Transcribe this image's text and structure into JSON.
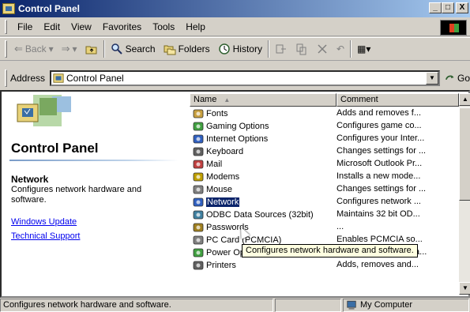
{
  "window": {
    "title": "Control Panel",
    "min_label": "_",
    "max_label": "□",
    "close_label": "X"
  },
  "menu": [
    "File",
    "Edit",
    "View",
    "Favorites",
    "Tools",
    "Help"
  ],
  "toolbar": {
    "back": "Back",
    "search": "Search",
    "folders": "Folders",
    "history": "History",
    "back_arrow": "⇐",
    "forward_arrow": "⇒",
    "dropdown": "▾",
    "undo": "↶",
    "views": "▦▾"
  },
  "address": {
    "label": "Address",
    "value": "Control Panel",
    "go": "Go",
    "dd": "▼"
  },
  "left": {
    "title": "Control Panel",
    "selected_name": "Network",
    "selected_desc": "Configures network hardware and software.",
    "links": [
      "Windows Update",
      "Technical Support"
    ]
  },
  "list": {
    "headers": {
      "name": "Name",
      "comment": "Comment",
      "sort_indicator": "▲"
    },
    "rows": [
      {
        "name": "Fonts",
        "comment": "Adds and removes f...",
        "icon": "fonts-icon"
      },
      {
        "name": "Gaming Options",
        "comment": "Configures game co...",
        "icon": "gaming-icon"
      },
      {
        "name": "Internet Options",
        "comment": "Configures your Inter...",
        "icon": "internet-icon"
      },
      {
        "name": "Keyboard",
        "comment": "Changes settings for ...",
        "icon": "keyboard-icon"
      },
      {
        "name": "Mail",
        "comment": "Microsoft Outlook Pr...",
        "icon": "mail-icon"
      },
      {
        "name": "Modems",
        "comment": "Installs a new mode...",
        "icon": "modem-icon"
      },
      {
        "name": "Mouse",
        "comment": "Changes settings for ...",
        "icon": "mouse-icon"
      },
      {
        "name": "Network",
        "comment": "Configures network ...",
        "icon": "network-icon",
        "selected": true
      },
      {
        "name": "ODBC Data Sources (32bit)",
        "comment": "Maintains 32 bit OD...",
        "icon": "odbc-icon"
      },
      {
        "name": "Passwords",
        "comment": "...",
        "icon": "passwords-icon"
      },
      {
        "name": "PC Card (PCMCIA)",
        "comment": "Enables PCMCIA so...",
        "icon": "pccard-icon"
      },
      {
        "name": "Power Options",
        "comment": "Configures energy-sa...",
        "icon": "power-icon"
      },
      {
        "name": "Printers",
        "comment": "Adds, removes and...",
        "icon": "printer-icon"
      }
    ]
  },
  "tooltip": "Configures network hardware and software.",
  "status": {
    "text": "Configures network hardware and software.",
    "zone": "My Computer"
  }
}
